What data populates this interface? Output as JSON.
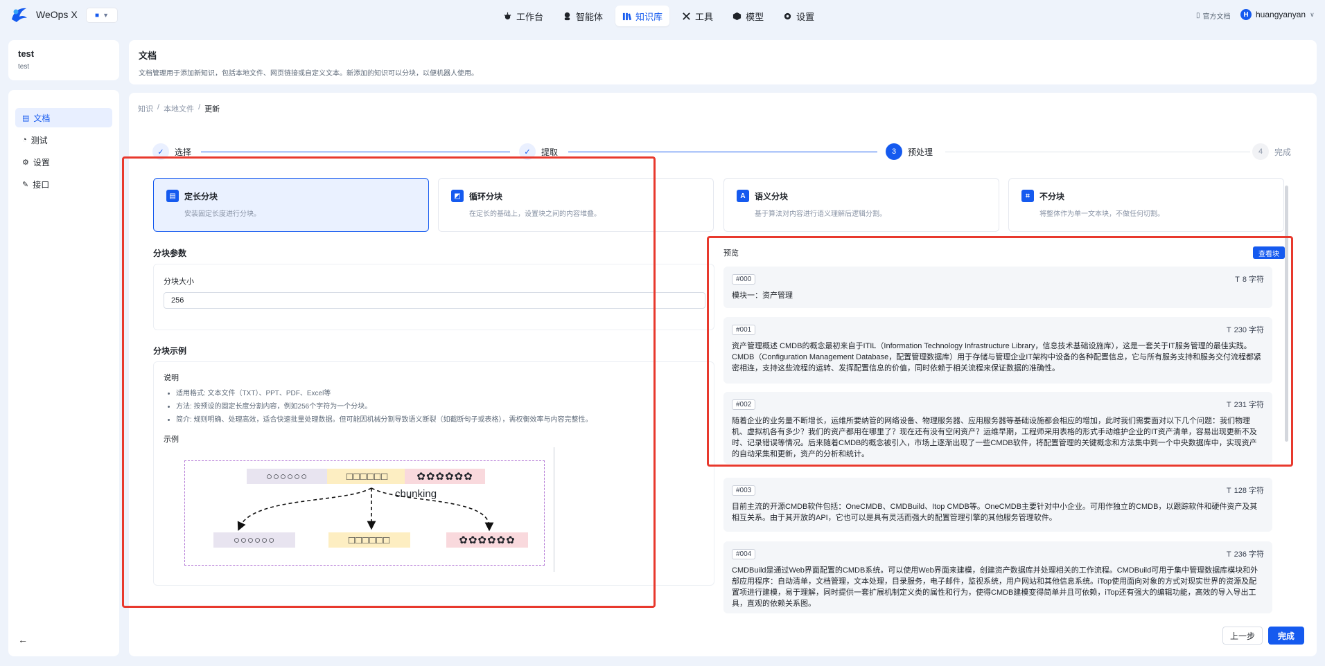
{
  "app": {
    "brand": "WeOps X"
  },
  "nav": [
    {
      "label": "工作台",
      "icon": "bug-icon",
      "active": false
    },
    {
      "label": "智能体",
      "icon": "agent-icon",
      "active": false
    },
    {
      "label": "知识库",
      "icon": "book-icon",
      "active": true
    },
    {
      "label": "工具",
      "icon": "tools-icon",
      "active": false
    },
    {
      "label": "模型",
      "icon": "cube-icon",
      "active": false
    },
    {
      "label": "设置",
      "icon": "gear-icon",
      "active": false
    }
  ],
  "topright": {
    "docs": "官方文档",
    "user": "huangyanyan",
    "avatar_letter": "H"
  },
  "sidebar": {
    "title": "test",
    "subtitle": "test",
    "items": [
      {
        "label": "文档",
        "icon": "doc-icon",
        "active": true
      },
      {
        "label": "测试",
        "icon": "test-icon",
        "active": false
      },
      {
        "label": "设置",
        "icon": "settings-icon",
        "active": false
      },
      {
        "label": "接口",
        "icon": "api-icon",
        "active": false
      }
    ]
  },
  "header": {
    "title": "文档",
    "desc": "文档管理用于添加新知识，包括本地文件、网页链接或自定义文本。新添加的知识可以分块，以便机器人使用。"
  },
  "breadcrumb": {
    "items": [
      "知识",
      "本地文件",
      "更新"
    ]
  },
  "steps": [
    {
      "label": "选择",
      "state": "done",
      "num": "1"
    },
    {
      "label": "提取",
      "state": "done",
      "num": "2"
    },
    {
      "label": "预处理",
      "state": "current",
      "num": "3"
    },
    {
      "label": "完成",
      "state": "wait",
      "num": "4"
    }
  ],
  "methods": [
    {
      "title": "定长分块",
      "desc": "安装固定长度进行分块。",
      "icon": "fixed-chunk-icon",
      "glyph": "▤",
      "selected": true
    },
    {
      "title": "循环分块",
      "desc": "在定长的基础上，设置块之间的内容堆叠。",
      "icon": "overlap-chunk-icon",
      "glyph": "◩",
      "selected": false
    },
    {
      "title": "语义分块",
      "desc": "基于算法对内容进行语义理解后逻辑分割。",
      "icon": "semantic-chunk-icon",
      "glyph": "A",
      "selected": false
    },
    {
      "title": "不分块",
      "desc": "将整体作为单一文本块，不做任何切割。",
      "icon": "no-chunk-icon",
      "glyph": "⌗",
      "selected": false
    }
  ],
  "params": {
    "section_title": "分块参数",
    "size_label": "分块大小",
    "size_value": "256"
  },
  "example": {
    "section_title": "分块示例",
    "explain_title": "说明",
    "bullets": [
      "适用格式: 文本文件（TXT）、PPT、PDF、Excel等",
      "方法: 按预设的固定长度分割内容，例如256个字符为一个分块。",
      "简介: 规则明确、处理高效，适合快速批量处理数据。但可能因机械分割导致语义断裂（如截断句子或表格），需权衡效率与内容完整性。"
    ],
    "example_title": "示例",
    "diagram": {
      "label": "chunking",
      "row1": [
        "○○○○○○",
        "□□□□□□",
        "✿✿✿✿✿✿"
      ],
      "row2": [
        "○○○○○○",
        "□□□□□□",
        "✿✿✿✿✿✿"
      ],
      "colors": [
        "#e8e4f0",
        "#fdeec2",
        "#f9d9dd"
      ]
    }
  },
  "preview": {
    "title": "预览",
    "view_button": "查看块",
    "chunks": [
      {
        "id": "#000",
        "chars": "8 字符",
        "text": "模块一：资产管理"
      },
      {
        "id": "#001",
        "chars": "230 字符",
        "text": "资产管理概述 CMDB的概念最初来自于ITIL（Information Technology Infrastructure Library，信息技术基础设施库），这是一套关于IT服务管理的最佳实践。CMDB（Configuration Management Database，配置管理数据库）用于存储与管理企业IT架构中设备的各种配置信息，它与所有服务支持和服务交付流程都紧密相连，支持这些流程的运转、发挥配置信息的价值，同时依赖于相关流程来保证数据的准确性。"
      },
      {
        "id": "#002",
        "chars": "231 字符",
        "text": "随着企业的业务量不断增长，运维所要纳管的网络设备、物理服务器、应用服务器等基础设施都会相应的增加，此时我们需要面对以下几个问题：我们物理机、虚拟机各有多少？我们的资产都用在哪里了？现在还有没有空闲资产？运维早期，工程师采用表格的形式手动维护企业的IT资产清单，容易出现更新不及时、记录错误等情况。后来随着CMDB的概念被引入，市场上逐渐出现了一些CMDB软件，将配置管理的关键概念和方法集中到一个中央数据库中，实现资产的自动采集和更新，资产的分析和统计。"
      },
      {
        "id": "#003",
        "chars": "128 字符",
        "text": "目前主流的开源CMDB软件包括：OneCMDB、CMDBuild、Itop CMDB等。OneCMDB主要针对中小企业。可用作独立的CMDB，以跟踪软件和硬件资产及其相互关系。由于其开放的API，它也可以是具有灵活而强大的配置管理引擎的其他服务管理软件。"
      },
      {
        "id": "#004",
        "chars": "236 字符",
        "text": "CMDBuild是通过Web界面配置的CMDB系统。可以使用Web界面来建模，创建资产数据库并处理相关的工作流程。CMDBuild可用于集中管理数据库模块和外部应用程序：自动清单，文档管理，文本处理，目录服务，电子邮件，监视系统，用户网站和其他信息系统。iTop使用面向对象的方式对现实世界的资源及配置项进行建模，易于理解，同时提供一套扩展机制定义类的属性和行为，使得CMDB建模变得简单并且可依赖，iTop还有强大的编辑功能，高效的导入导出工具，直观的依赖关系图。"
      }
    ]
  },
  "footer": {
    "prev": "上一步",
    "finish": "完成"
  },
  "colors": {
    "primary": "#155aef",
    "highlight": "#e8392d"
  }
}
